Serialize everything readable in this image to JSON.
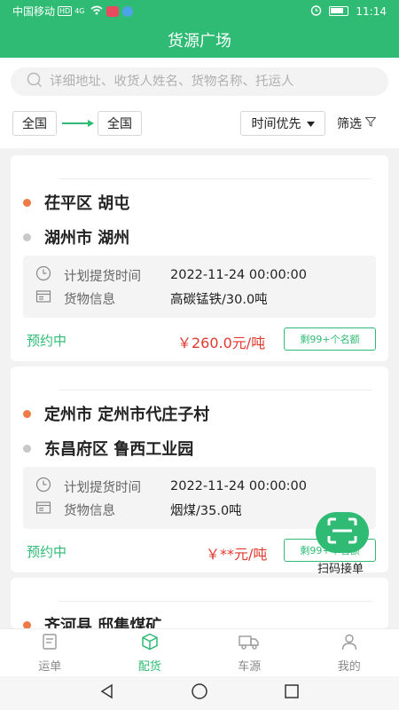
{
  "status_bar": {
    "carrier": "中国移动",
    "hd": "HD",
    "network": "4G",
    "time": "11:14"
  },
  "header": {
    "title": "货源广场"
  },
  "search": {
    "placeholder": "详细地址、收货人姓名、货物名称、托运人"
  },
  "filters": {
    "from_region": "全国",
    "to_region": "全国",
    "sort_label": "时间优先",
    "filter_label": "筛选"
  },
  "labels": {
    "pickup_time": "计划提货时间",
    "cargo_info": "货物信息"
  },
  "cards": [
    {
      "from": "茌平区 胡屯",
      "to": "湖州市 湖州",
      "pickup_time": "2022-11-24 00:00:00",
      "cargo": "高碳锰铁/30.0吨",
      "status": "预约中",
      "price": "￥260.0元/吨",
      "quota": "剩99+个名额"
    },
    {
      "from": "定州市 定州市代庄子村",
      "to": "东昌府区 鲁西工业园",
      "pickup_time": "2022-11-24 00:00:00",
      "cargo": "烟煤/35.0吨",
      "status": "预约中",
      "price": "￥**元/吨",
      "quota": "剩99+个名额"
    },
    {
      "from": "齐河县 邸集煤矿"
    }
  ],
  "scan": {
    "label": "扫码接单"
  },
  "tabs": [
    {
      "label": "运单",
      "icon": "waybill-icon",
      "active": false
    },
    {
      "label": "配货",
      "icon": "box-icon",
      "active": true
    },
    {
      "label": "车源",
      "icon": "truck-icon",
      "active": false
    },
    {
      "label": "我的",
      "icon": "user-icon",
      "active": false
    }
  ],
  "colors": {
    "brand": "#2fbb74",
    "price": "#e03a2f",
    "origin_dot": "#ee7a45"
  }
}
